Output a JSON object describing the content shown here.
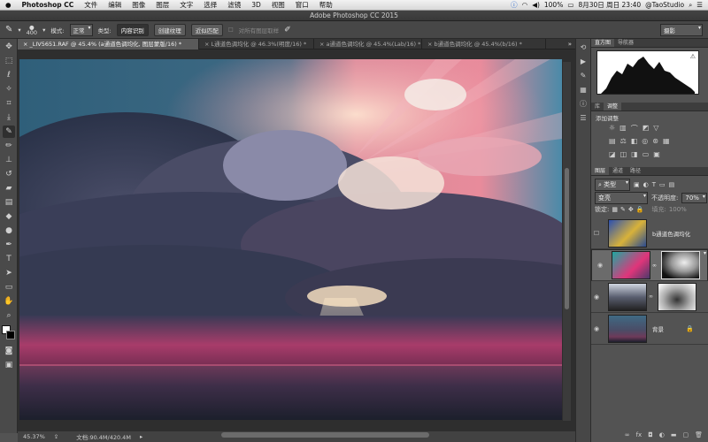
{
  "menubar": {
    "app": "Photoshop CC",
    "items": [
      "文件",
      "编辑",
      "图像",
      "图层",
      "文字",
      "选择",
      "滤镜",
      "3D",
      "视图",
      "窗口",
      "帮助"
    ],
    "battery": "100%",
    "datetime": "8月30日 周日  23:40",
    "user": "@TaoStudio"
  },
  "window": {
    "title": "Adobe Photoshop CC 2015"
  },
  "options": {
    "brush_size": "400",
    "mode_label": "模式:",
    "mode_value": "正常",
    "type_label": "类型:",
    "type_buttons": [
      "内容识别",
      "创建纹理",
      "近似匹配"
    ],
    "sample_all": "对所有图层取样",
    "workspace": "摄影"
  },
  "tabs": [
    {
      "label": "_LIV5651.RAF @ 45.4% (a通道色调均化, 图层蒙版/16) *",
      "active": true
    },
    {
      "label": "L通道色调均化 @ 46.3%(明度/16) *",
      "active": false
    },
    {
      "label": "a通道色调均化 @ 45.4%(Lab/16) *",
      "active": false
    },
    {
      "label": "b通道色调均化 @ 45.4%(b/16) *",
      "active": false
    }
  ],
  "status": {
    "zoom": "45.37%",
    "doc": "文档:90.4M/420.4M"
  },
  "panels": {
    "histogram_tabs": [
      "直方图",
      "导航器"
    ],
    "adjust_tabs": [
      "库",
      "调整"
    ],
    "adjust_title": "添加调整",
    "layers_tabs": [
      "图层",
      "通道",
      "路径"
    ],
    "filter_kind": "类型",
    "blend_mode": "变亮",
    "opacity_label": "不透明度:",
    "opacity_value": "70%",
    "lock_label": "锁定:",
    "fill_label": "填充:",
    "fill_value": "100%"
  },
  "layers": [
    {
      "name": "b通道色调均化",
      "visible": false,
      "selected": false,
      "mask": false
    },
    {
      "name": "",
      "visible": true,
      "selected": true,
      "mask": true
    },
    {
      "name": "",
      "visible": true,
      "selected": false,
      "mask": true
    },
    {
      "name": "背景",
      "visible": true,
      "selected": false,
      "mask": false
    }
  ]
}
